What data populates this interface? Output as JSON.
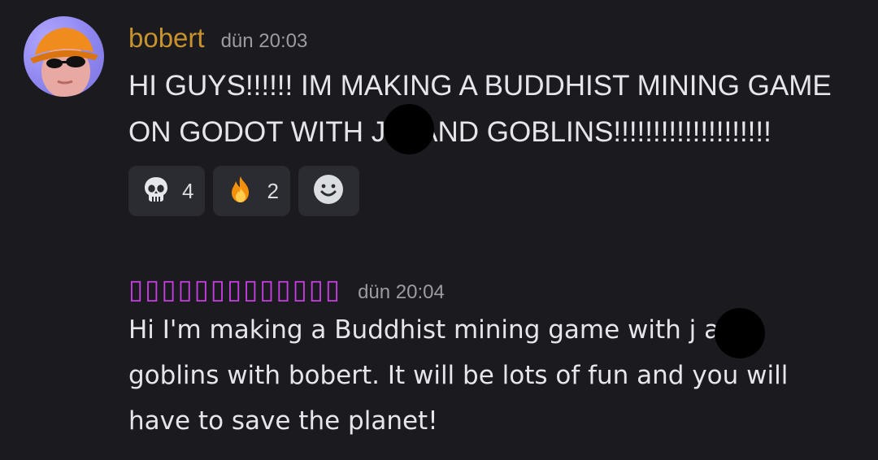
{
  "messages": [
    {
      "author": "bobert",
      "author_color": "#c8922c",
      "timestamp": "dün 20:03",
      "content": "HI GUYS!!!!!! IM MAKING A BUDDHIST MINING GAME\nON GODOT WITH J     S AND GOBLINS!!!!!!!!!!!!!!!!!!!!",
      "reactions": [
        {
          "icon": "skull-icon",
          "count": "4"
        },
        {
          "icon": "fire-icon",
          "count": "2"
        }
      ],
      "add_reaction_icon": "smiley-icon"
    },
    {
      "author": "▯▯▯▯▯▯▯▯▯▯▯▯▯",
      "author_color": "#c93de5",
      "timestamp": "dün 20:04",
      "content": "Hi I'm making a Buddhist mining game with j       and\ngoblins with bobert. It will be lots of fun and you will\nhave to save the planet!"
    }
  ],
  "colors": {
    "background": "#1b1b1f",
    "reaction_bg": "#2b2c31",
    "timestamp": "#9a9ba3",
    "text": "#e6e6ea"
  }
}
